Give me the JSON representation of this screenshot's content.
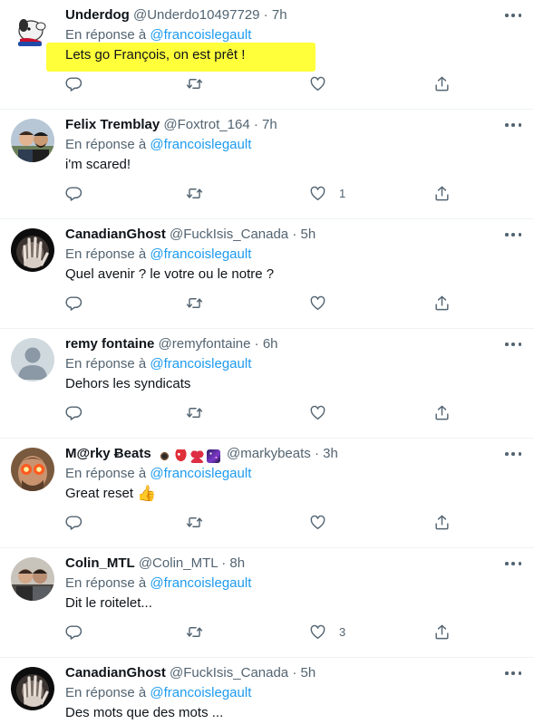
{
  "reply_prefix": "En réponse à",
  "tweets": [
    {
      "name": "Underdog",
      "handle": "@Underdo10497729",
      "time": "7h",
      "mention": "@francoislegault",
      "text": "Lets go François, on est prêt !",
      "likes": "",
      "highlighted": true
    },
    {
      "name": "Felix Tremblay",
      "handle": "@Foxtrot_164",
      "time": "7h",
      "mention": "@francoislegault",
      "text": "i'm scared!",
      "likes": "1"
    },
    {
      "name": "CanadianGhost",
      "handle": "@FuckIsis_Canada",
      "time": "5h",
      "mention": "@francoislegault",
      "text": "Quel avenir ? le votre ou le notre ?",
      "likes": ""
    },
    {
      "name": "remy fontaine",
      "handle": "@remyfontaine",
      "time": "6h",
      "mention": "@francoislegault",
      "text": "Dehors les syndicats",
      "likes": ""
    },
    {
      "name": "M@rky Ƀeats",
      "handle": "@markybeats",
      "time": "3h",
      "mention": "@francoislegault",
      "text": "Great reset",
      "likes": "",
      "emojis": [
        "eye-emoji",
        "mushroom-emoji",
        "heart-emoji",
        "galaxy-emoji"
      ],
      "trailing_emoji": "👍"
    },
    {
      "name": "Colin_MTL",
      "handle": "@Colin_MTL",
      "time": "8h",
      "mention": "@francoislegault",
      "text": "Dit le roitelet...",
      "likes": "3"
    },
    {
      "name": "CanadianGhost",
      "handle": "@FuckIsis_Canada",
      "time": "5h",
      "mention": "@francoislegault",
      "text": "Des mots que des mots ...",
      "likes": ""
    }
  ],
  "colors": {
    "link": "#1d9bf0",
    "secondary_text": "#536471",
    "primary_text": "#0f1419",
    "highlight": "#ffff3a",
    "divider": "#eff3f4"
  },
  "icons": [
    "reply-icon",
    "retweet-icon",
    "like-icon",
    "share-icon",
    "more-icon"
  ]
}
